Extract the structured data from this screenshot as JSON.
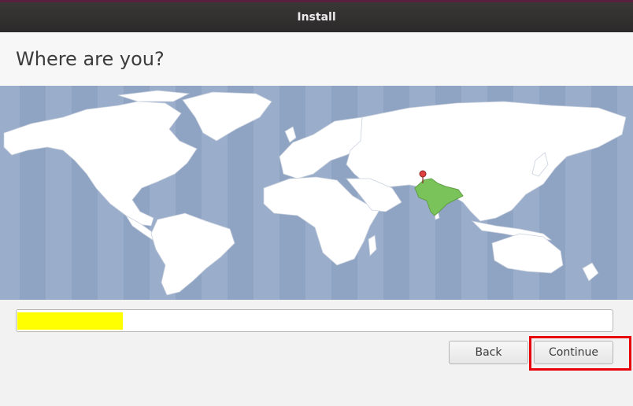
{
  "window": {
    "title": "Install"
  },
  "page": {
    "heading": "Where are you?"
  },
  "map": {
    "selected_region": "India",
    "highlight_color": "#7ac35a",
    "pin_color": "#e04040",
    "ocean_color": "#8fa3c2",
    "land_color": "#ffffff"
  },
  "timezone_field": {
    "value": "",
    "redaction_color": "#ffff00"
  },
  "buttons": {
    "back_label": "Back",
    "continue_label": "Continue"
  },
  "annotation": {
    "highlight_color": "#e8000b"
  }
}
